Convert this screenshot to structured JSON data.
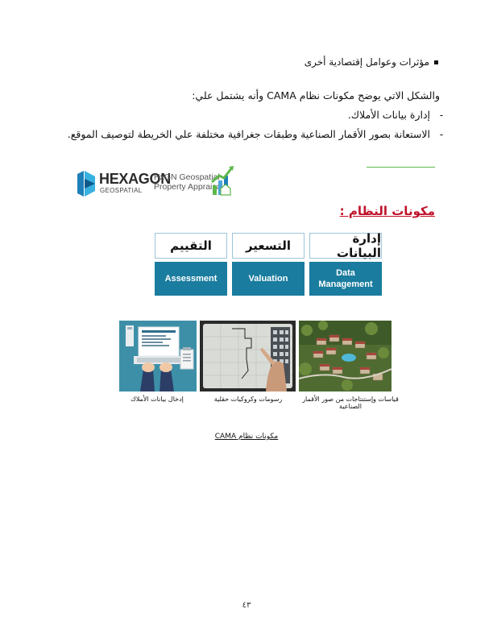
{
  "bullet_text": "مؤثرات وعوامل إقتصادية أخرى",
  "intro_text": "والشكل الاتي يوضح مكونات نظام CAMA وأنه يشتمل علي:",
  "list_items": [
    "إدارة بيانات الأملاك.",
    "الاستعانة بصور الأقمار الصناعية وطبقات جغرافية مختلفة علي الخريطة لتوصيف الموقع."
  ],
  "dash_char": "-",
  "logos": {
    "hexagon_name": "HEXAGON",
    "hexagon_sub": "GEOSPATIAL",
    "hxgn_line1": "HxGN Geospatial",
    "hxgn_line2": "Property Appraisal"
  },
  "section_title": "مكونات النظام :",
  "components": [
    {
      "arabic": "التقييم",
      "english": "Assessment"
    },
    {
      "arabic": "التسعير",
      "english": "Valuation"
    },
    {
      "arabic": "إدارة البيانات",
      "english": "Data Management"
    }
  ],
  "image_captions": [
    "إدخال بيانات الأملاك",
    "رسومات وكروكيات حقلية",
    "قياسات وإستنتاجات من صور الأقمار الصناعية"
  ],
  "figure_caption": "مكونات نظام CAMA",
  "page_number": "٤٣",
  "colors": {
    "accent_red": "#c0122a",
    "component_blue": "#1a7c9e",
    "green_line": "#5db84a"
  }
}
